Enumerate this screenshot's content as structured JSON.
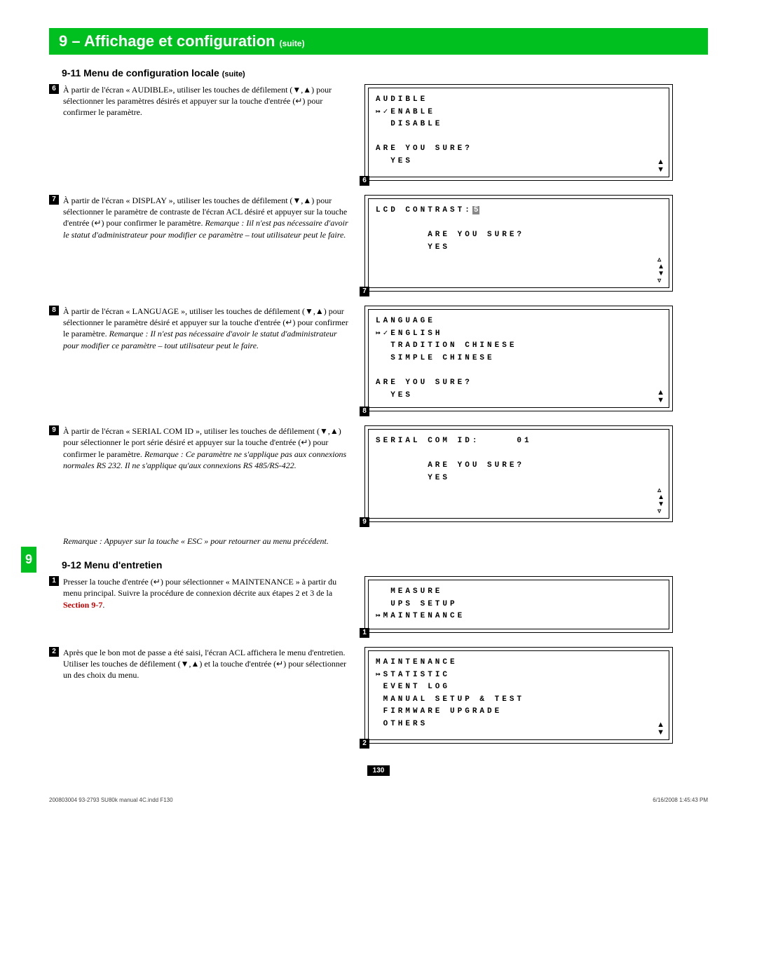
{
  "banner": {
    "num": "9",
    "title": "Affichage et configuration",
    "suite": "(suite)"
  },
  "sidetab": "9",
  "sub1": {
    "num": "9-11",
    "title": "Menu de configuration locale",
    "suite": "(suite)"
  },
  "steps1": {
    "s6": {
      "n": "6",
      "t": "À partir de l'écran « AUDIBLE», utiliser les touches de défilement (▼,▲) pour sélectionner les paramètres désirés et appuyer sur la touche d'entrée (↵) pour confirmer le paramètre."
    },
    "s7": {
      "n": "7",
      "t1": "À partir de l'écran « DISPLAY », utiliser les touches de défilement (▼,▲) pour sélectionner le paramètre de contraste de l'écran ACL désiré et appuyer sur la touche d'entrée (↵) pour confirmer le paramètre. ",
      "i": "Remarque : Iil n'est pas nécessaire d'avoir le statut d'administrateur pour modifier ce paramètre – tout utilisateur peut le faire."
    },
    "s8": {
      "n": "8",
      "t1": "À partir de l'écran « LANGUAGE », utiliser les touches de défilement (▼,▲) pour sélectionner le paramètre désiré et appuyer sur la touche d'entrée (↵) pour confirmer le paramètre. ",
      "i": "Remarque : Il n'est pas nécessaire d'avoir le statut d'administrateur pour modifier ce paramètre – tout utilisateur peut le faire."
    },
    "s9": {
      "n": "9",
      "t1": "À partir de l'écran « SERIAL COM ID », utiliser les touches de défilement (▼,▲) pour sélectionner le port série désiré et appuyer sur la touche d'entrée (↵) pour confirmer le paramètre. ",
      "i": "Remarque : Ce paramètre ne s'applique pas aux connexions normales RS 232. Il ne s'applique qu'aux connexions RS 485/RS-422."
    },
    "escnote": "Remarque : Appuyer sur la touche « ESC » pour retourner au menu précédent."
  },
  "lcd6": {
    "badge": "6",
    "l1": "AUDIBLE",
    "l2": "↦✓ENABLE",
    "l3": "  DISABLE",
    "l4": "",
    "l5": "ARE YOU SURE?",
    "l6": "  YES"
  },
  "lcd7": {
    "badge": "7",
    "l1a": "LCD CONTRAST:",
    "l1b": "5",
    "l3": "       ARE YOU SURE?",
    "l4": "       YES"
  },
  "lcd8": {
    "badge": "8",
    "l1": "LANGUAGE",
    "l2": "↦✓ENGLISH",
    "l3": "  TRADITION CHINESE",
    "l4": "  SIMPLE CHINESE",
    "l5": "",
    "l6": "ARE YOU SURE?",
    "l7": "  YES"
  },
  "lcd9": {
    "badge": "9",
    "l1": "SERIAL COM ID:     01",
    "l3": "       ARE YOU SURE?",
    "l4": "       YES"
  },
  "sub2": {
    "num": "9-12",
    "title": "Menu d'entretien"
  },
  "steps2": {
    "s1": {
      "n": "1",
      "t1": "Presser la touche d'entrée (↵) pour sélectionner « MAINTENANCE » à partir du menu principal. Suivre la procédure de connexion décrite aux étapes 2 et 3 de la ",
      "link": "Section 9-7",
      "t2": "."
    },
    "s2": {
      "n": "2",
      "t": "Après que le bon mot de passe a été saisi, l'écran ACL affichera le menu d'entretien. Utiliser les touches de défilement (▼,▲) et la touche d'entrée (↵) pour sélectionner un des choix du menu."
    }
  },
  "lcdM1": {
    "badge": "1",
    "l1": "  MEASURE",
    "l2": "  UPS SETUP",
    "l3": "↦MAINTENANCE"
  },
  "lcdM2": {
    "badge": "2",
    "l1": "MAINTENANCE",
    "l2": "↦STATISTIC",
    "l3": " EVENT LOG",
    "l4": " MANUAL SETUP & TEST",
    "l5": " FIRMWARE UPGRADE",
    "l6": " OTHERS"
  },
  "page": "130",
  "footer": {
    "left": "200803004 93-2793 SU80k manual 4C.indd   F130",
    "right": "6/16/2008   1:45:43 PM"
  }
}
